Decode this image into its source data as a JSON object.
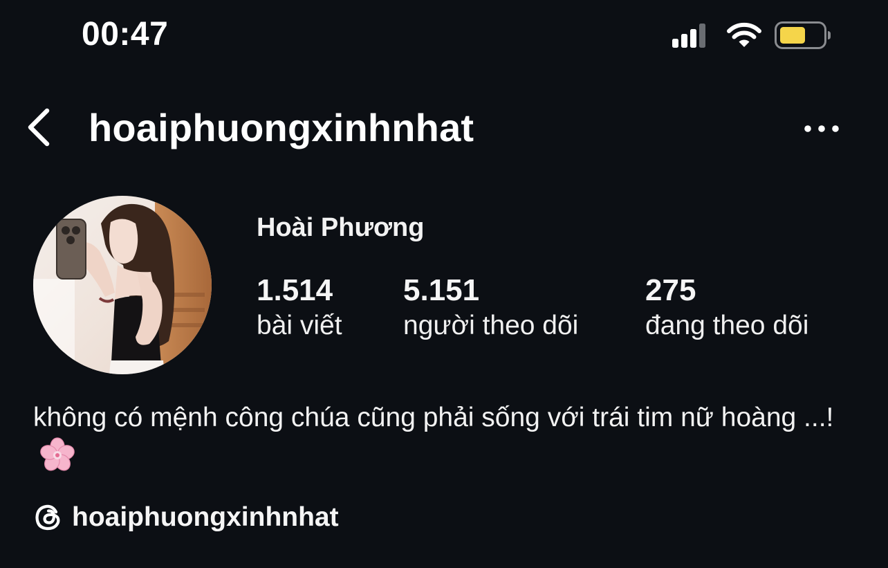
{
  "status_bar": {
    "time": "00:47",
    "icons": [
      "cellular-signal-icon",
      "wifi-icon",
      "battery-icon"
    ],
    "battery_color": "#f5d54a"
  },
  "header": {
    "username": "hoaiphuongxinhnhat",
    "back_icon": "chevron-left-icon",
    "more_icon": "more-horizontal-icon"
  },
  "profile": {
    "display_name": "Hoài Phương",
    "stats": {
      "posts": {
        "value": "1.514",
        "label": "bài viết"
      },
      "followers": {
        "value": "5.151",
        "label": "người theo dõi"
      },
      "following": {
        "value": "275",
        "label": "đang theo dõi"
      }
    },
    "bio": "không có mệnh công chúa cũng phải sống với trái tim nữ hoàng ...!",
    "bio_emoji": "cherry-blossom-icon",
    "threads": {
      "icon": "threads-icon",
      "handle": "hoaiphuongxinhnhat"
    }
  },
  "colors": {
    "background": "#0c0f14",
    "text": "#f5f5f5"
  }
}
